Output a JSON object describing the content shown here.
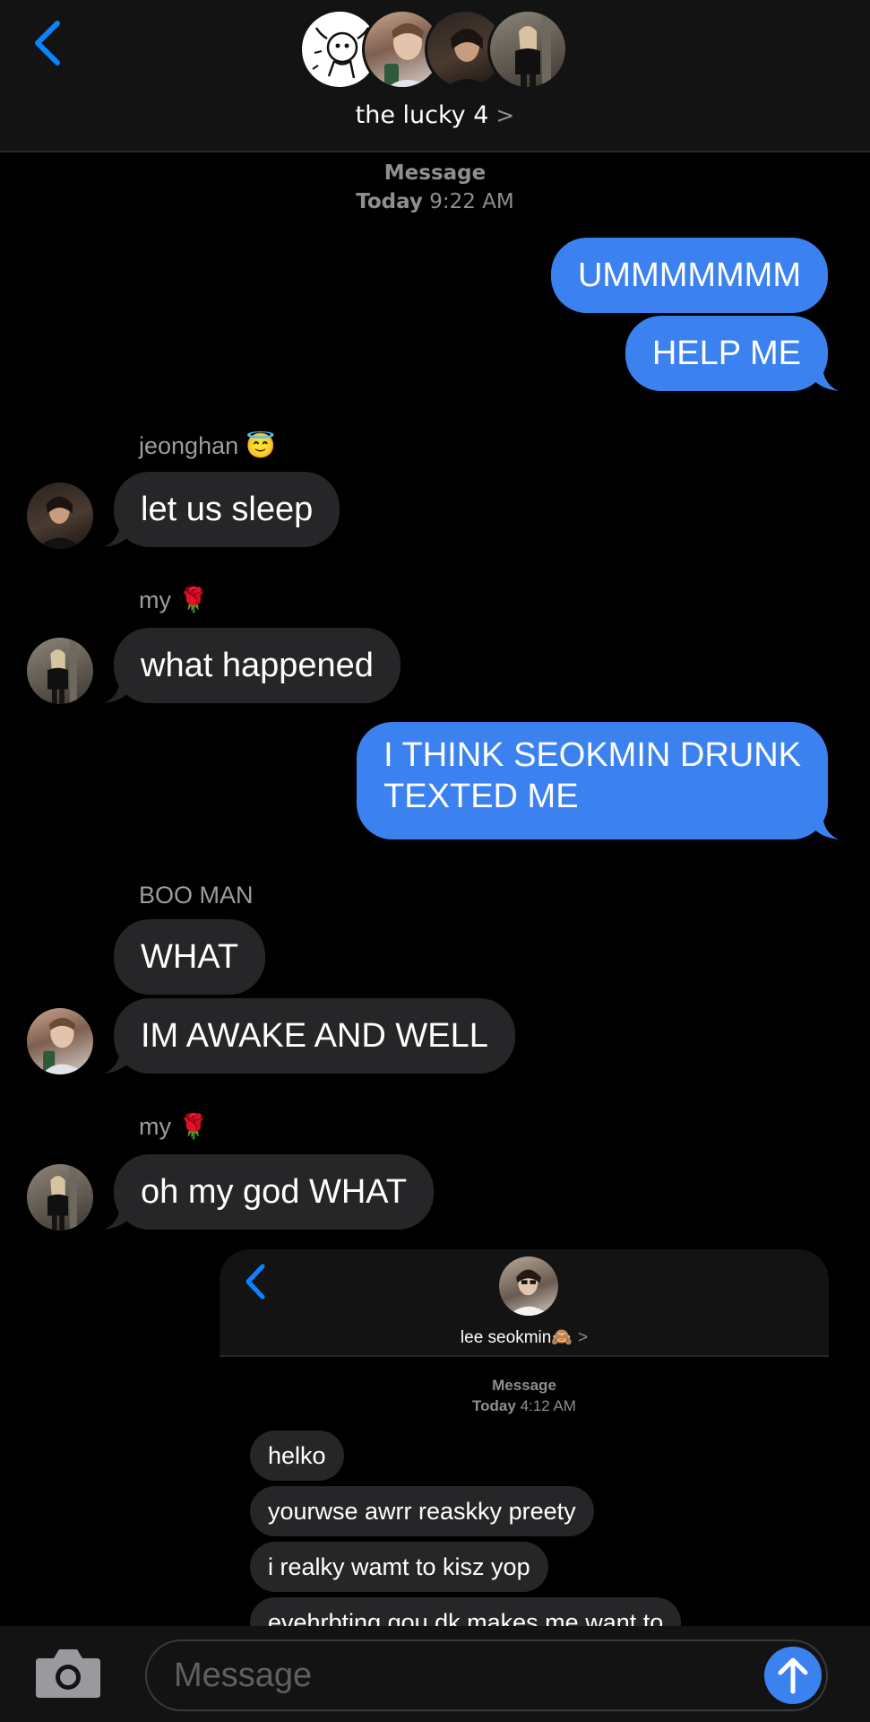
{
  "header": {
    "group_name": "the lucky 4",
    "chevron": ">"
  },
  "thread": {
    "timestamp_label": "Message",
    "timestamp_day": "Today",
    "timestamp_time": "9:22 AM"
  },
  "messages": [
    {
      "from": "me",
      "text": "UMMMMMMM"
    },
    {
      "from": "me",
      "text": "HELP ME"
    },
    {
      "sender": "jeonghan",
      "sender_emoji": "😇",
      "text": "let us sleep"
    },
    {
      "sender": "my",
      "sender_emoji": "🌹",
      "text": "what happened"
    },
    {
      "from": "me",
      "text_line1": "I THINK SEOKMIN DRUNK",
      "text_line2": "TEXTED ME"
    },
    {
      "sender": "BOO MAN",
      "text": "WHAT"
    },
    {
      "text": "IM AWAKE AND WELL"
    },
    {
      "sender": "my",
      "sender_emoji": "🌹",
      "text": "oh my god WHAT"
    }
  ],
  "screenshot": {
    "contact_name": "lee seokmin🙈",
    "chevron": ">",
    "timestamp_label": "Message",
    "timestamp_day": "Today",
    "timestamp_time": "4:12 AM",
    "messages": [
      "helko",
      "yourwse awrr reaskky preety",
      "i realky wamt to kisz yop",
      "evehrbting gou dk makes me want to"
    ]
  },
  "composer": {
    "placeholder": "Message"
  },
  "colors": {
    "sent_bubble": "#3b82f0",
    "received_bubble": "#262628",
    "accent": "#0a84ff"
  },
  "icons": [
    "back-chevron-icon",
    "camera-icon",
    "send-arrow-icon"
  ]
}
